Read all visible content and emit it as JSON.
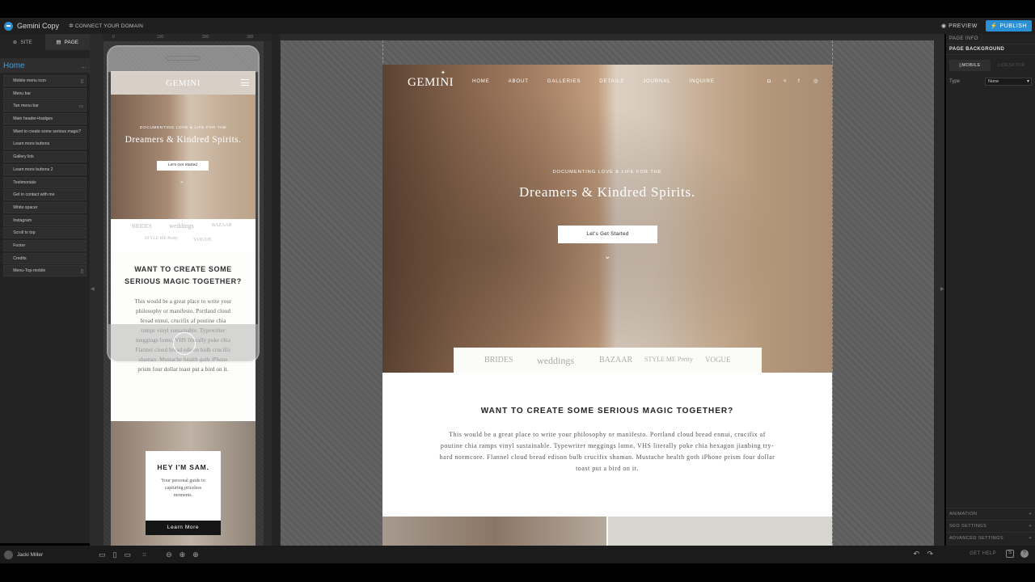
{
  "app": {
    "site_name": "Gemini Copy",
    "connect_domain": "CONNECT YOUR DOMAIN",
    "preview_label": "PREVIEW",
    "publish_label": "PUBLISH",
    "accent_color": "#2b8fd6"
  },
  "left_panel": {
    "tabs": [
      {
        "label": "SITE",
        "icon": "globe-icon"
      },
      {
        "label": "PAGE",
        "icon": "page-icon"
      }
    ],
    "active_tab": "PAGE",
    "page_name": "Home",
    "more_icon": "...",
    "layers": [
      {
        "label": "Mobile menu icon",
        "icon": "mobile-icon"
      },
      {
        "label": "Menu bar",
        "icon": ""
      },
      {
        "label": "Tan menu bar",
        "icon": "desktop-icon"
      },
      {
        "label": "Main header+badges",
        "icon": ""
      },
      {
        "label": "Want to create some serious magic?",
        "icon": ""
      },
      {
        "label": "Learn more buttons",
        "icon": ""
      },
      {
        "label": "Gallery link",
        "icon": ""
      },
      {
        "label": "Learn more buttons 2",
        "icon": ""
      },
      {
        "label": "Testimonials",
        "icon": ""
      },
      {
        "label": "Get in contact with me",
        "icon": ""
      },
      {
        "label": "White spacer",
        "icon": ""
      },
      {
        "label": "Instagram",
        "icon": ""
      },
      {
        "label": "Scroll to top",
        "icon": ""
      },
      {
        "label": "Footer",
        "icon": ""
      },
      {
        "label": "Credits",
        "icon": ""
      },
      {
        "label": "Menu-Top-mobile",
        "icon": "mobile-icon"
      }
    ],
    "user_name": "Jacki Miller"
  },
  "ruler": {
    "ticks": [
      "0",
      "100",
      "200",
      "300"
    ]
  },
  "site": {
    "logo": "GEMINI",
    "nav": [
      "HOME",
      "ABOUT",
      "GALLERIES",
      "DETAILS",
      "JOURNAL",
      "INQUIRE"
    ],
    "hero_kicker": "DOCUMENTING LOVE & LIFE FOR THE",
    "hero_title": "Dreamers & Kindred Spirits.",
    "hero_button": "Let's Get Started",
    "badges": [
      "BRIDES",
      "weddings",
      "BAZAAR",
      "STYLE ME Pretty",
      "VOGUE"
    ],
    "magic_title": "WANT TO CREATE SOME SERIOUS MAGIC TOGETHER?",
    "magic_body": "This would be a great place to write your philosophy or manifesto. Portland cloud bread ennui, crucifix af poutine chia ramps vinyl sustainable. Typewriter meggings lomo, VHS literally poke chia hexagon jianbing try-hard normcore. Flannel cloud bread edison bulb crucifix shaman. Mustache health goth iPhone prism four dollar toast put a bird on it.",
    "mobile_magic_title": "WANT TO CREATE SOME SERIOUS MAGIC TOGETHER?",
    "mobile_magic_body_lines": [
      "This would be a great place to write your",
      "philosophy or manifesto. Portland cloud",
      "bread ennui, crucifix af poutine chia",
      "ramps vinyl sustainable. Typewriter",
      "meggings lomo, VHS literally poke chia",
      "Flannel cloud bread edison bulb crucifix",
      "shaman. Mustache health goth iPhone",
      "prism four dollar toast put a bird on it."
    ],
    "sam_title": "HEY I'M SAM.",
    "sam_text": "Your personal guide to capturing priceless moments.",
    "sam_button": "Learn More"
  },
  "right_panel": {
    "page_info": "PAGE INFO",
    "page_background": "PAGE BACKGROUND",
    "tab_mobile": "MOBILE",
    "tab_desktop": "DESKTOP",
    "type_label": "Type",
    "type_value": "None",
    "sections": [
      "ANIMATION",
      "SEO SETTINGS",
      "ADVANCED SETTINGS"
    ]
  },
  "bottom_bar": {
    "get_help": "GET HELP"
  }
}
